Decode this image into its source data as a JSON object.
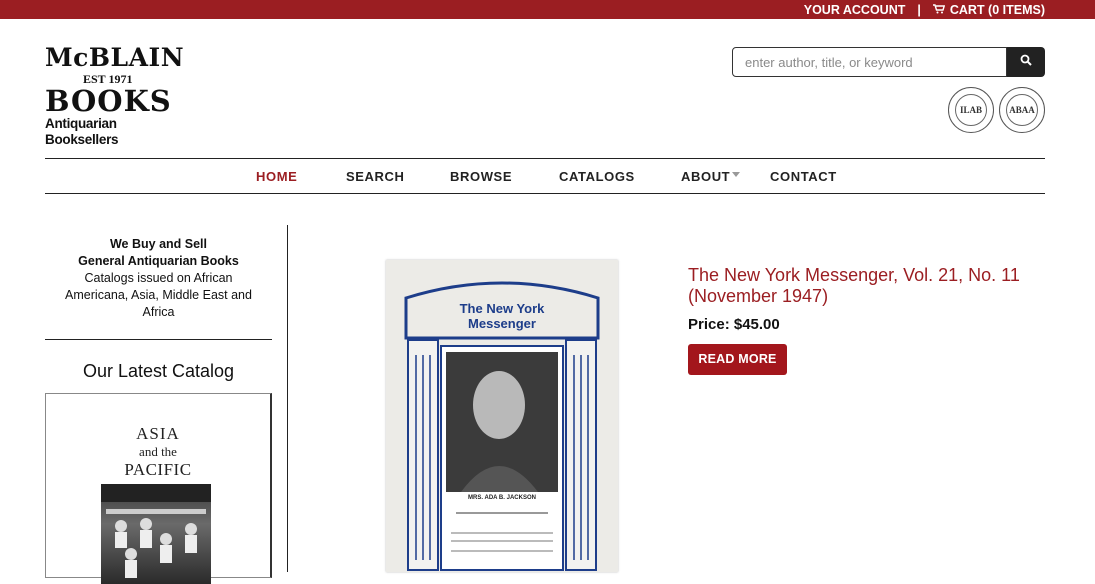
{
  "topbar": {
    "account_label": "YOUR ACCOUNT",
    "separator": "|",
    "cart_label": "CART (0 ITEMS)",
    "cart_icon": "shopping-cart-icon"
  },
  "logo": {
    "line1": "McBLAIN",
    "line2": "EST 1971",
    "line3": "BOOKS",
    "line4": "Antiquarian Booksellers"
  },
  "search": {
    "placeholder": "enter author, title, or keyword",
    "value": "",
    "button_icon": "search-icon"
  },
  "seals": {
    "ilab": "ILAB",
    "abaa": "ABAA"
  },
  "nav": {
    "items": [
      {
        "label": "HOME"
      },
      {
        "label": "SEARCH"
      },
      {
        "label": "BROWSE"
      },
      {
        "label": "CATALOGS"
      },
      {
        "label": "ABOUT"
      },
      {
        "label": "CONTACT"
      }
    ]
  },
  "sidebar": {
    "buy_line1": "We Buy and Sell",
    "buy_line2": "General Antiquarian Books",
    "buy_line3": "Catalogs issued on African Americana, Asia, Middle East and Africa",
    "latest_title": "Our Latest Catalog",
    "catalog_title_1": "ASIA",
    "catalog_title_2": "and the",
    "catalog_title_3": "PACIFIC"
  },
  "product": {
    "image_title": "The New York Messenger",
    "image_caption": "MRS. ADA B. JACKSON",
    "title": "The New York Messenger, Vol. 21, No. 11 (November 1947)",
    "price": "Price: $45.00",
    "button": "READ MORE"
  },
  "colors": {
    "brand_red": "#9b1e22",
    "button_red": "#a3161c"
  }
}
